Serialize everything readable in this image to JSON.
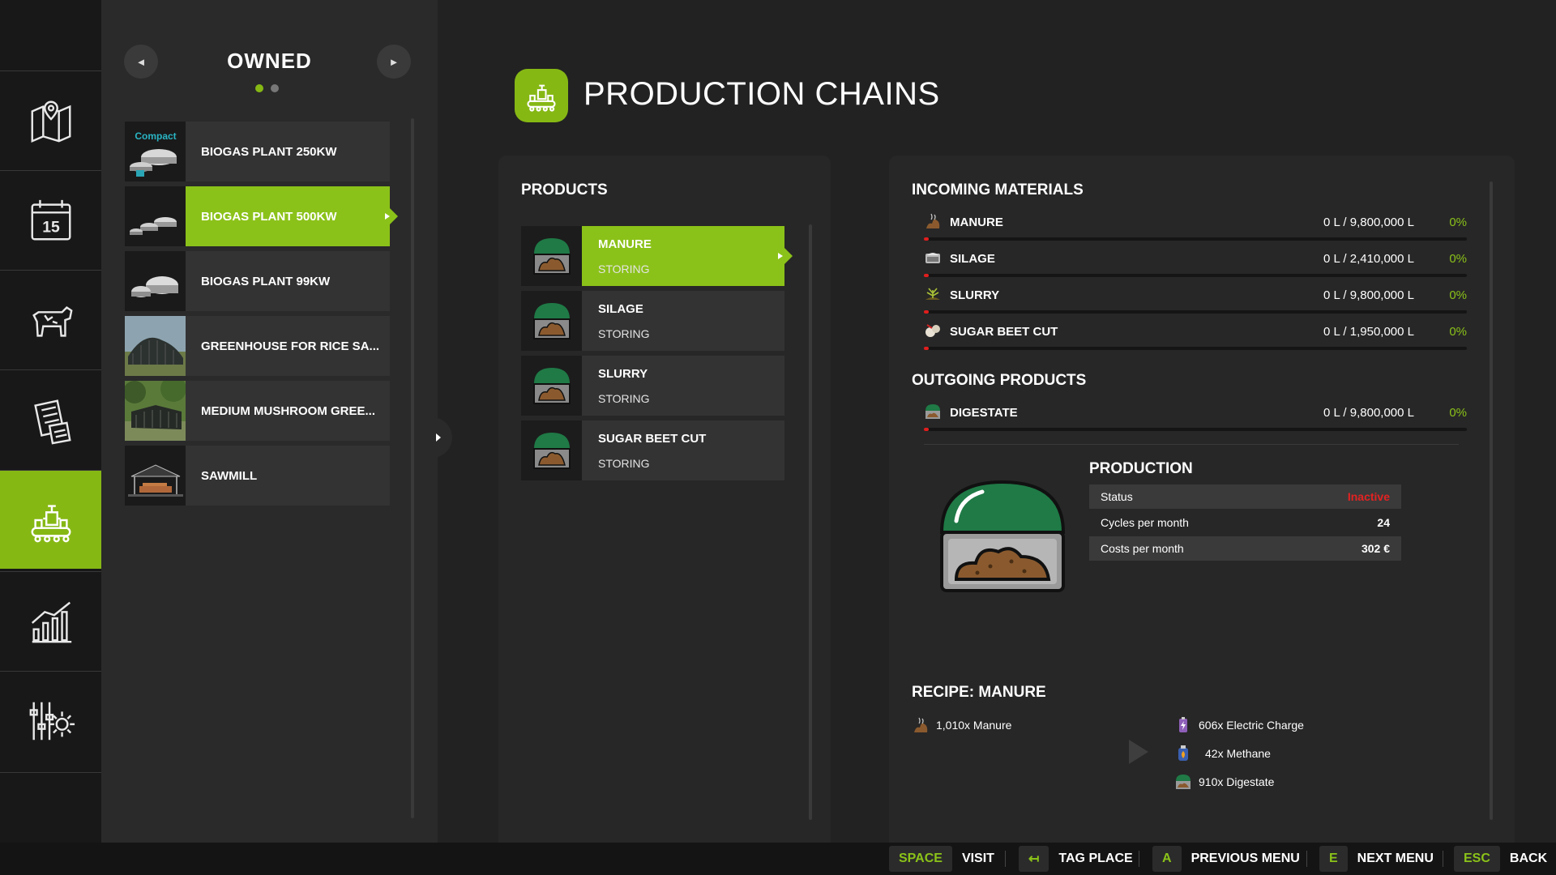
{
  "rail": {
    "items": [
      {
        "icon": "map-icon"
      },
      {
        "icon": "calendar-icon",
        "badge": "15"
      },
      {
        "icon": "cow-icon"
      },
      {
        "icon": "contracts-icon"
      },
      {
        "icon": "production-icon",
        "active": true
      },
      {
        "icon": "statistics-icon"
      },
      {
        "icon": "settings-icon"
      }
    ]
  },
  "owned": {
    "title": "OWNED",
    "prev_icon": "◄",
    "next_icon": "►",
    "pages": 2,
    "current_page": 1,
    "items": [
      {
        "label": "BIOGAS PLANT 250KW",
        "thumb_label": "Compact"
      },
      {
        "label": "BIOGAS PLANT 500KW",
        "active": true
      },
      {
        "label": "BIOGAS PLANT 99KW"
      },
      {
        "label": "GREENHOUSE FOR RICE SA..."
      },
      {
        "label": "MEDIUM MUSHROOM GREE..."
      },
      {
        "label": "SAWMILL"
      }
    ]
  },
  "header": {
    "title": "PRODUCTION CHAINS"
  },
  "products": {
    "title": "PRODUCTS",
    "items": [
      {
        "name": "MANURE",
        "status": "STORING",
        "active": true
      },
      {
        "name": "SILAGE",
        "status": "STORING"
      },
      {
        "name": "SLURRY",
        "status": "STORING"
      },
      {
        "name": "SUGAR BEET CUT",
        "status": "STORING"
      }
    ]
  },
  "incoming": {
    "title": "INCOMING MATERIALS",
    "items": [
      {
        "name": "MANURE",
        "amount": "0 L / 9,800,000 L",
        "percent": "0%",
        "fill": 0
      },
      {
        "name": "SILAGE",
        "amount": "0 L / 2,410,000 L",
        "percent": "0%",
        "fill": 0
      },
      {
        "name": "SLURRY",
        "amount": "0 L / 9,800,000 L",
        "percent": "0%",
        "fill": 0
      },
      {
        "name": "SUGAR BEET CUT",
        "amount": "0 L / 1,950,000 L",
        "percent": "0%",
        "fill": 0
      }
    ]
  },
  "outgoing": {
    "title": "OUTGOING PRODUCTS",
    "items": [
      {
        "name": "DIGESTATE",
        "amount": "0 L / 9,800,000 L",
        "percent": "0%",
        "fill": 0
      }
    ]
  },
  "production": {
    "title": "PRODUCTION",
    "stats": [
      {
        "label": "Status",
        "value": "Inactive"
      },
      {
        "label": "Cycles per month",
        "value": "24"
      },
      {
        "label": "Costs per month",
        "value": "302 €"
      }
    ]
  },
  "recipe": {
    "title": "RECIPE: MANURE",
    "inputs": [
      {
        "label": "1,010x Manure"
      }
    ],
    "outputs": [
      {
        "label": "606x Electric Charge"
      },
      {
        "label": "42x Methane"
      },
      {
        "label": "910x Digestate"
      }
    ]
  },
  "bottombar": {
    "hints": [
      {
        "key": "SPACE",
        "label": "VISIT"
      },
      {
        "key": "↤",
        "label": "TAG PLACE"
      },
      {
        "key": "A",
        "label": "PREVIOUS MENU"
      },
      {
        "key": "E",
        "label": "NEXT MENU"
      },
      {
        "key": "ESC",
        "label": "BACK"
      }
    ]
  },
  "colors": {
    "accent": "#8bc219",
    "inactive": "#e32222",
    "bar_fill": "#e01e1e"
  }
}
